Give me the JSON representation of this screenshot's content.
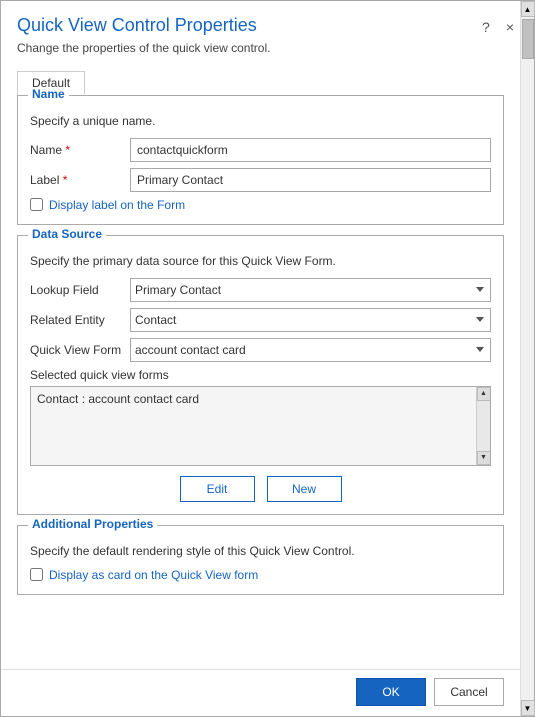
{
  "dialog": {
    "title": "Quick View Control Properties",
    "subtitle": "Change the properties of the quick view control.",
    "help_btn": "?",
    "close_btn": "×"
  },
  "tabs": [
    {
      "label": "Default",
      "active": true
    }
  ],
  "name_section": {
    "legend": "Name",
    "description": "Specify a unique name.",
    "name_label": "Name",
    "name_required": "*",
    "name_value": "contactquickform",
    "label_label": "Label",
    "label_required": "*",
    "label_value": "Primary Contact",
    "checkbox_label": "Display label on the Form"
  },
  "data_source_section": {
    "legend": "Data Source",
    "description": "Specify the primary data source for this Quick View Form.",
    "lookup_field_label": "Lookup Field",
    "lookup_field_value": "Primary Contact",
    "lookup_field_options": [
      "Primary Contact"
    ],
    "related_entity_label": "Related Entity",
    "related_entity_value": "Contact",
    "related_entity_options": [
      "Contact"
    ],
    "quick_view_form_label": "Quick View Form",
    "quick_view_form_value": "account contact card",
    "quick_view_form_options": [
      "account contact card"
    ],
    "selected_label": "Selected quick view forms",
    "listbox_items": [
      "Contact : account contact card"
    ],
    "edit_btn": "Edit",
    "new_btn": "New"
  },
  "additional_section": {
    "legend": "Additional Properties",
    "description": "Specify the default rendering style of this Quick View Control.",
    "checkbox_label": "Display as card on the Quick View form"
  },
  "footer": {
    "ok_label": "OK",
    "cancel_label": "Cancel"
  }
}
